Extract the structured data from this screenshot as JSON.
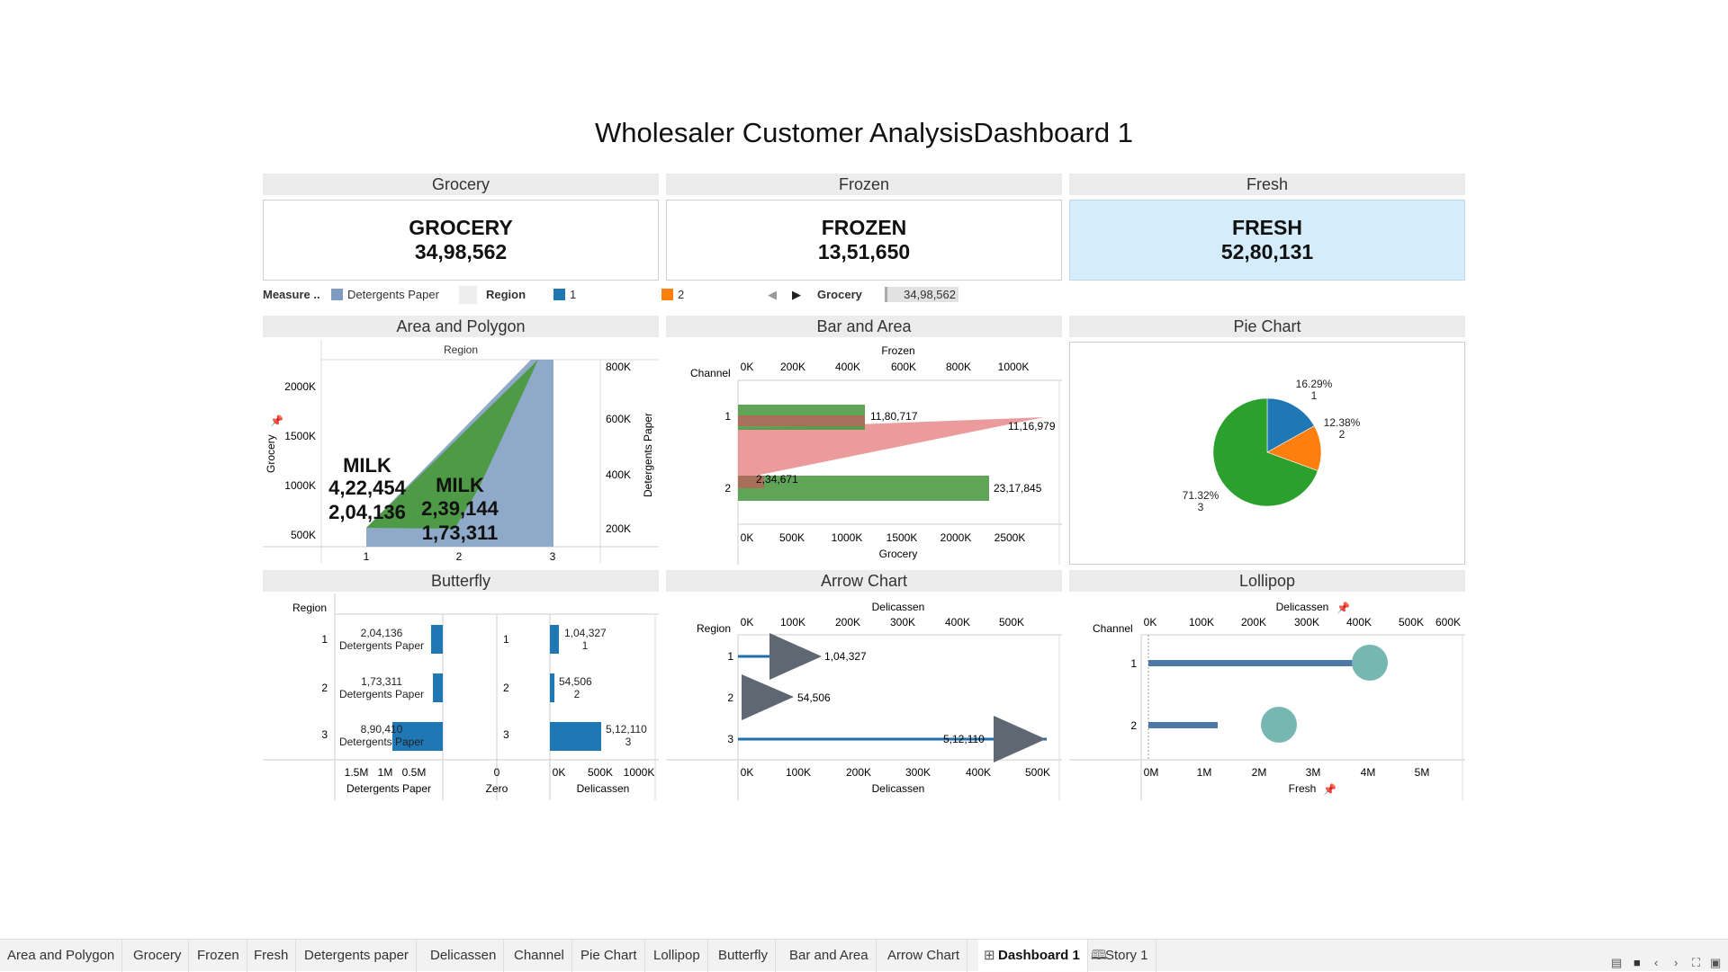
{
  "title": "Wholesaler Customer AnalysisDashboard 1",
  "kpis": {
    "grocery": {
      "header": "Grocery",
      "label": "GROCERY",
      "value": "34,98,562"
    },
    "frozen": {
      "header": "Frozen",
      "label": "FROZEN",
      "value": "13,51,650"
    },
    "fresh": {
      "header": "Fresh",
      "label": "FRESH",
      "value": "52,80,131"
    }
  },
  "legend": {
    "measure_label": "Measure ..",
    "measure_item": "Detergents Paper",
    "region_label": "Region",
    "region_items": [
      "1",
      "2"
    ],
    "grocery_filter_label": "Grocery",
    "grocery_filter_value": "34,98,562",
    "colors": {
      "detergents": "#7f9cc0",
      "region1": "#1f77b4",
      "region2": "#ff7f0e",
      "region3": "#2ca02c"
    }
  },
  "panels": {
    "area": "Area and Polygon",
    "bar": "Bar and Area",
    "pie": "Pie Chart",
    "butterfly": "Butterfly",
    "arrow": "Arrow Chart",
    "lollipop": "Lollipop"
  },
  "chart_data": [
    {
      "type": "area",
      "title": "Area and Polygon",
      "column_header": "Region",
      "categories": [
        "1",
        "2",
        "3"
      ],
      "left_axis": {
        "label": "Grocery",
        "ticks": [
          "2000K",
          "1500K",
          "1000K",
          "500K"
        ]
      },
      "right_axis": {
        "label": "Detergents Paper",
        "ticks": [
          "800K",
          "600K",
          "400K",
          "200K"
        ]
      },
      "annotations": [
        {
          "category": "1",
          "text": [
            "MILK",
            "4,22,454",
            "2,04,136"
          ]
        },
        {
          "category": "2",
          "text": [
            "MILK",
            "2,39,144",
            "1,73,311"
          ]
        }
      ]
    },
    {
      "type": "bar",
      "title": "Bar and Area",
      "rows_header": "Channel",
      "rows": [
        "1",
        "2"
      ],
      "top_axis": {
        "label": "Frozen",
        "ticks": [
          "0K",
          "200K",
          "400K",
          "600K",
          "800K",
          "1000K"
        ]
      },
      "bottom_axis": {
        "label": "Grocery",
        "ticks": [
          "0K",
          "500K",
          "1000K",
          "1500K",
          "2000K",
          "2500K"
        ]
      },
      "series": [
        {
          "name": "Grocery",
          "values": [
            1180717,
            2317845
          ]
        },
        {
          "name": "Frozen",
          "values": [
            234671,
            1116979
          ]
        }
      ],
      "labels": {
        "grocery": [
          "11,80,717",
          "23,17,845"
        ],
        "frozen": [
          "2,34,671",
          "11,16,979"
        ]
      }
    },
    {
      "type": "pie",
      "title": "Pie Chart",
      "slices": [
        {
          "label": "1",
          "percent": 16.29,
          "text": "16.29%",
          "color": "#1f77b4"
        },
        {
          "label": "2",
          "percent": 12.38,
          "text": "12.38%",
          "color": "#ff7f0e"
        },
        {
          "label": "3",
          "percent": 71.32,
          "text": "71.32%",
          "color": "#2ca02c"
        }
      ]
    },
    {
      "type": "bar",
      "title": "Butterfly",
      "rows_header": "Region",
      "rows": [
        "1",
        "2",
        "3"
      ],
      "columns": [
        {
          "label": "Detergents Paper",
          "ticks": [
            "1.5M",
            "1M",
            "0.5M"
          ],
          "values": [
            204136,
            173311,
            890410
          ],
          "labels": [
            "2,04,136",
            "1,73,311",
            "8,90,410"
          ],
          "sublabel": "Detergents Paper"
        },
        {
          "label": "Zero",
          "ticks": [
            "0"
          ]
        },
        {
          "label": "Delicassen",
          "ticks": [
            "0K",
            "500K",
            "1000K"
          ],
          "values": [
            104327,
            54506,
            512110
          ],
          "labels": [
            "1,04,327",
            "54,506",
            "5,12,110"
          ]
        }
      ]
    },
    {
      "type": "bar",
      "title": "Arrow Chart",
      "rows_header": "Region",
      "rows": [
        "1",
        "2",
        "3"
      ],
      "top_axis": {
        "label": "Delicassen",
        "ticks": [
          "0K",
          "100K",
          "200K",
          "300K",
          "400K",
          "500K"
        ]
      },
      "bottom_axis": {
        "label": "Delicassen",
        "ticks": [
          "0K",
          "100K",
          "200K",
          "300K",
          "400K",
          "500K"
        ]
      },
      "values": [
        104327,
        54506,
        512110
      ],
      "labels": [
        "1,04,327",
        "54,506",
        "5,12,110"
      ]
    },
    {
      "type": "bar",
      "title": "Lollipop",
      "rows_header": "Channel",
      "rows": [
        "1",
        "2"
      ],
      "top_axis": {
        "label": "Delicassen",
        "ticks": [
          "0K",
          "100K",
          "200K",
          "300K",
          "400K",
          "500K",
          "600K"
        ]
      },
      "bottom_axis": {
        "label": "Fresh",
        "ticks": [
          "0M",
          "1M",
          "2M",
          "3M",
          "4M",
          "5M"
        ]
      },
      "bar_values": [
        4000000,
        1300000
      ],
      "circle_values": [
        4100000,
        2400000
      ]
    }
  ],
  "tabs": [
    "Area and Polygon",
    "Grocery",
    "Frozen",
    "Fresh",
    "Detergents paper",
    "Delicassen",
    "Channel",
    "Pie Chart",
    "Lollipop",
    "Butterfly",
    "Bar and Area",
    "Arrow Chart",
    "Dashboard 1",
    "Story 1"
  ],
  "active_tab": "Dashboard 1"
}
